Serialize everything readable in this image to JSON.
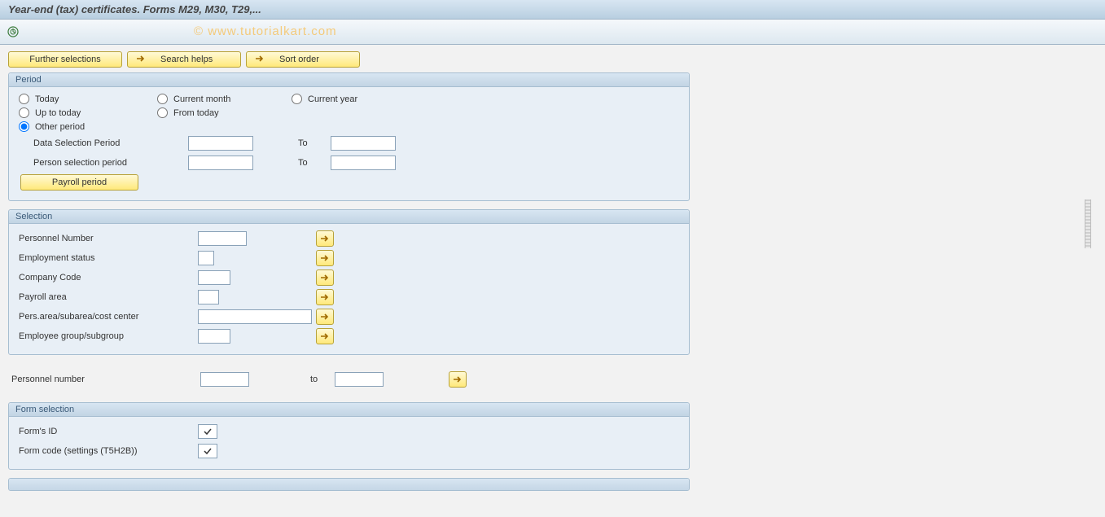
{
  "title": "Year-end (tax) certificates. Forms M29, M30, T29,...",
  "watermark": "© www.tutorialkart.com",
  "toolbar": {
    "further_selections": "Further selections",
    "search_helps": "Search helps",
    "sort_order": "Sort order"
  },
  "period": {
    "header": "Period",
    "today": "Today",
    "current_month": "Current month",
    "current_year": "Current year",
    "up_to_today": "Up to today",
    "from_today": "From today",
    "other_period": "Other period",
    "data_selection_period": "Data Selection Period",
    "data_from": "",
    "to_label": "To",
    "data_to": "",
    "person_selection_period": "Person selection period",
    "person_from": "",
    "person_to": "",
    "payroll_period": "Payroll period"
  },
  "selection": {
    "header": "Selection",
    "personnel_number": "Personnel Number",
    "personnel_number_val": "",
    "employment_status": "Employment status",
    "employment_status_val": "",
    "company_code": "Company Code",
    "company_code_val": "",
    "payroll_area": "Payroll area",
    "payroll_area_val": "",
    "pers_area": "Pers.area/subarea/cost center",
    "pers_area_val": "",
    "employee_group": "Employee group/subgroup",
    "employee_group_val": ""
  },
  "loose": {
    "personnel_number": "Personnel number",
    "pn_from": "",
    "to_label": "to",
    "pn_to": ""
  },
  "form_selection": {
    "header": "Form selection",
    "forms_id": "Form's ID",
    "form_code": "Form code (settings (T5H2B))"
  }
}
